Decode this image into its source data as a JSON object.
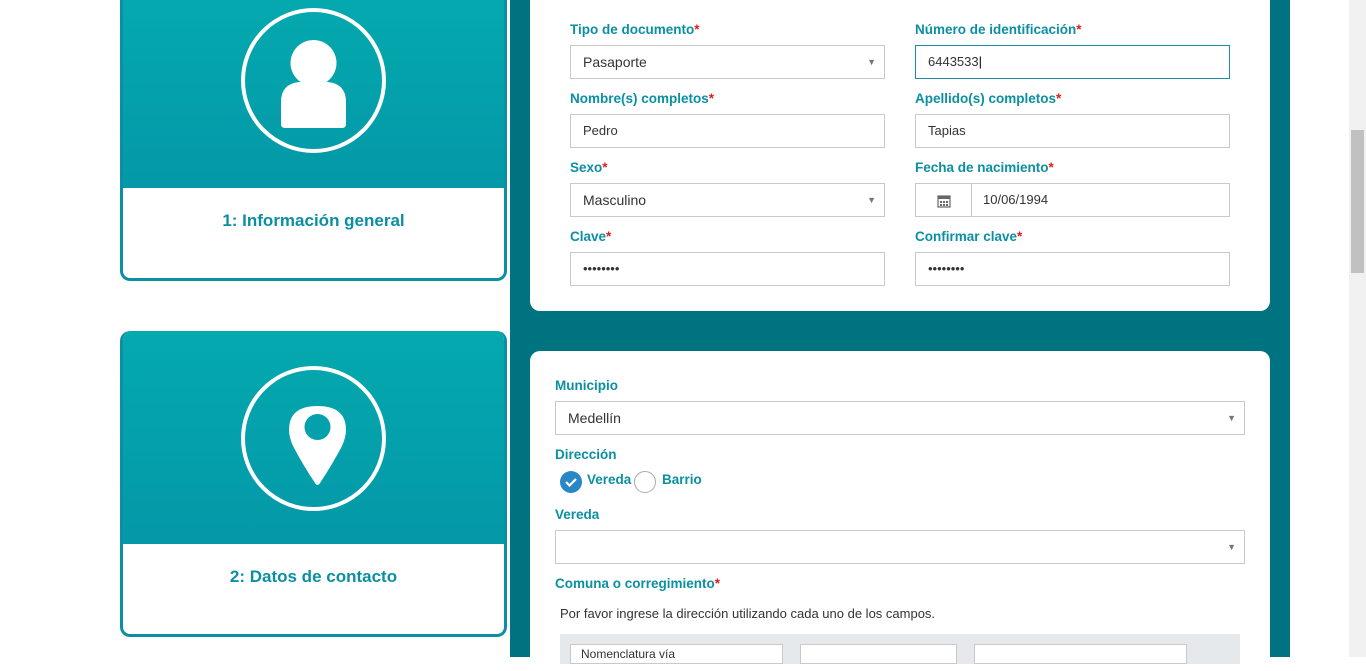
{
  "steps": [
    {
      "title": "1: Información general",
      "icon": "user-icon"
    },
    {
      "title": "2: Datos de contacto",
      "icon": "map-pin-icon"
    }
  ],
  "general": {
    "doc_type": {
      "label": "Tipo de documento",
      "value": "Pasaporte"
    },
    "id_number": {
      "label": "Número de identificación",
      "value": "6443533"
    },
    "names": {
      "label": "Nombre(s) completos",
      "value": "Pedro"
    },
    "surnames": {
      "label": "Apellido(s) completos",
      "value": "Tapias"
    },
    "sex": {
      "label": "Sexo",
      "value": "Masculino"
    },
    "birth": {
      "label": "Fecha de nacimiento",
      "value": "10/06/1994"
    },
    "password": {
      "label": "Clave",
      "value": "••••••••"
    },
    "confirm": {
      "label": "Confirmar clave",
      "value": "••••••••"
    },
    "required_mark": "*"
  },
  "contact": {
    "municipio": {
      "label": "Municipio",
      "value": "Medellín"
    },
    "direccion": {
      "label": "Dirección",
      "options": [
        "Vereda",
        "Barrio"
      ],
      "selected": "Vereda"
    },
    "vereda": {
      "label": "Vereda",
      "value": ""
    },
    "comuna": {
      "label": "Comuna o corregimiento"
    },
    "hint": "Por favor ingrese la dirección utilizando cada uno de los campos.",
    "addr_first": "Nomenclatura vía"
  },
  "colors": {
    "teal": "#007380",
    "accent": "#0b8fa3",
    "required": "#e21b1b",
    "radio_on": "#2a87c7"
  }
}
